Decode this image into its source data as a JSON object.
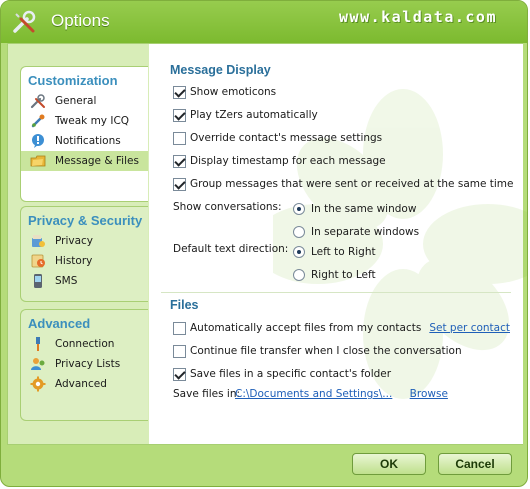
{
  "window": {
    "title": "Options",
    "watermark": "www.kaldata.com"
  },
  "sidebar": {
    "groups": [
      {
        "title": "Customization",
        "items": [
          {
            "label": "General",
            "icon": "wrench-screwdriver-icon"
          },
          {
            "label": "Tweak my ICQ",
            "icon": "tweak-icon"
          },
          {
            "label": "Notifications",
            "icon": "notification-bubble-icon"
          },
          {
            "label": "Message & Files",
            "icon": "message-folder-icon",
            "selected": true
          }
        ]
      },
      {
        "title": "Privacy & Security",
        "items": [
          {
            "label": "Privacy",
            "icon": "privacy-lock-icon"
          },
          {
            "label": "History",
            "icon": "history-icon"
          },
          {
            "label": "SMS",
            "icon": "sms-phone-icon"
          }
        ]
      },
      {
        "title": "Advanced",
        "items": [
          {
            "label": "Connection",
            "icon": "connection-plug-icon"
          },
          {
            "label": "Privacy Lists",
            "icon": "privacy-lists-icon"
          },
          {
            "label": "Advanced",
            "icon": "advanced-gear-icon"
          }
        ]
      }
    ]
  },
  "message_display": {
    "title": "Message Display",
    "options": [
      {
        "label": "Show emoticons",
        "checked": true
      },
      {
        "label": "Play tZers automatically",
        "checked": true
      },
      {
        "label": "Override contact's message settings",
        "checked": false
      },
      {
        "label": "Display timestamp for each message",
        "checked": true
      },
      {
        "label": "Group messages that were sent or received at the same time",
        "checked": true
      }
    ],
    "show_conversations": {
      "label": "Show conversations:",
      "options": [
        {
          "label": "In the same window",
          "checked": true
        },
        {
          "label": "In separate windows",
          "checked": false
        }
      ]
    },
    "text_direction": {
      "label": "Default text direction:",
      "options": [
        {
          "label": "Left to Right",
          "checked": true
        },
        {
          "label": "Right to Left",
          "checked": false
        }
      ]
    }
  },
  "files": {
    "title": "Files",
    "auto_accept": {
      "label": "Automatically accept files from my contacts",
      "checked": false
    },
    "set_per_contact_link": "Set per contact",
    "continue_transfer": {
      "label": "Continue file transfer when I close the conversation",
      "checked": false
    },
    "save_specific_folder": {
      "label": "Save files in a specific contact's folder",
      "checked": true
    },
    "save_files_in_label": "Save files in:",
    "save_path": "C:\\Documents and Settings\\...",
    "browse_link": "Browse"
  },
  "buttons": {
    "ok": "OK",
    "cancel": "Cancel"
  },
  "colors": {
    "accent_green": "#7cba2f",
    "group_title_blue": "#3b8fbd",
    "section_title_blue": "#2a6f9a",
    "link_blue": "#1f5fb8"
  }
}
